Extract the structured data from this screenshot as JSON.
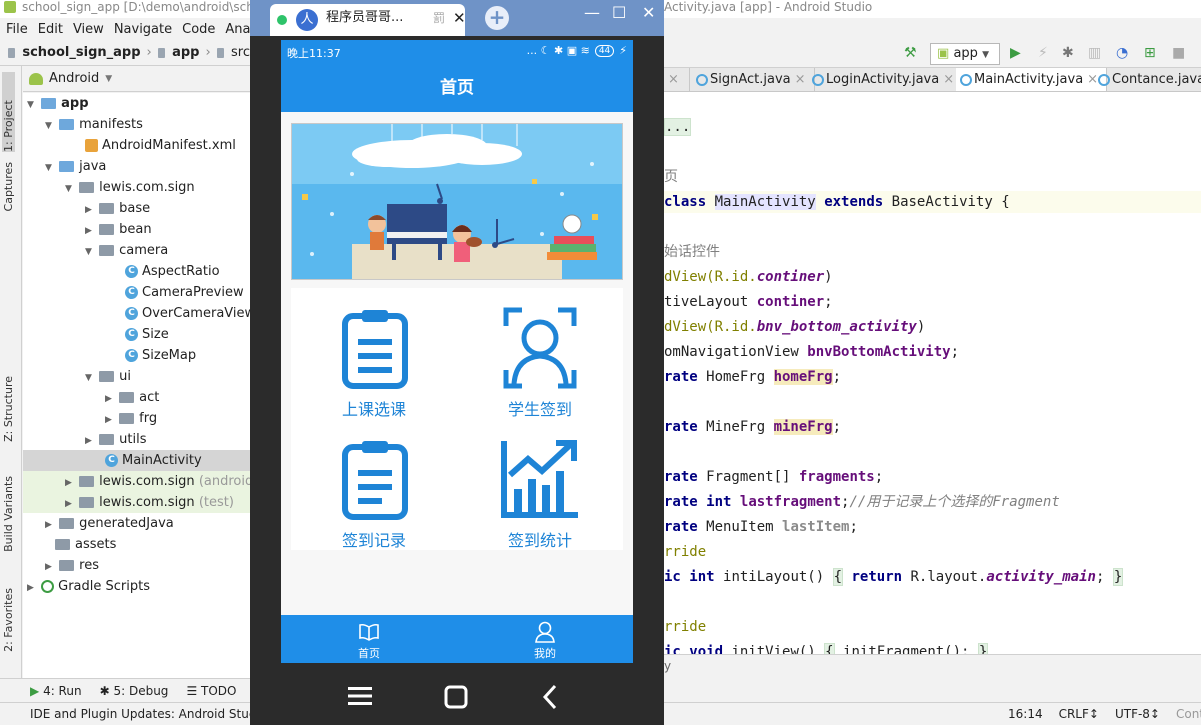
{
  "ide": {
    "title_left": "school_sign_app [D:\\demo\\android\\sch",
    "title_right": "Activity.java [app] - Android Studio",
    "menu": [
      "File",
      "Edit",
      "View",
      "Navigate",
      "Code",
      "Analy"
    ],
    "breadcrumb": [
      "school_sign_app",
      "app",
      "src"
    ],
    "project_view": "Android",
    "left_tabs": [
      "1: Project",
      "Captures",
      "Z: Structure",
      "Build Variants",
      "2: Favorites"
    ],
    "tree": [
      {
        "label": "app",
        "type": "module"
      },
      {
        "label": "manifests",
        "type": "folder"
      },
      {
        "label": "AndroidManifest.xml",
        "type": "xml"
      },
      {
        "label": "java",
        "type": "folder"
      },
      {
        "label": "lewis.com.sign",
        "type": "package"
      },
      {
        "label": "base",
        "type": "package"
      },
      {
        "label": "bean",
        "type": "package"
      },
      {
        "label": "camera",
        "type": "package"
      },
      {
        "label": "AspectRatio",
        "type": "class"
      },
      {
        "label": "CameraPreview",
        "type": "class"
      },
      {
        "label": "OverCameraView",
        "type": "class"
      },
      {
        "label": "Size",
        "type": "class"
      },
      {
        "label": "SizeMap",
        "type": "class"
      },
      {
        "label": "ui",
        "type": "package"
      },
      {
        "label": "act",
        "type": "package"
      },
      {
        "label": "frg",
        "type": "package"
      },
      {
        "label": "utils",
        "type": "package"
      },
      {
        "label": "MainActivity",
        "type": "class"
      },
      {
        "label": "lewis.com.sign",
        "suffix": "(androidTe",
        "type": "package"
      },
      {
        "label": "lewis.com.sign",
        "suffix": "(test)",
        "type": "package"
      },
      {
        "label": "generatedJava",
        "type": "folder"
      },
      {
        "label": "assets",
        "type": "folder"
      },
      {
        "label": "res",
        "type": "folder"
      },
      {
        "label": "Gradle Scripts",
        "type": "gradle"
      }
    ],
    "bottom_tools": [
      "4: Run",
      "5: Debug",
      "TODO"
    ],
    "status_message": "IDE and Plugin Updates: Android Stuc",
    "status_right": [
      "16:14",
      "CRLF↕",
      "UTF-8↕",
      "Context:"
    ],
    "run_config": "app",
    "editor_tabs": [
      {
        "label": "SignAct.java",
        "active": false
      },
      {
        "label": "LoginActivity.java",
        "active": false
      },
      {
        "label": "MainActivity.java",
        "active": true
      },
      {
        "label": "Contance.java",
        "active": false
      }
    ],
    "code": {
      "l1": "...",
      "l2": "页",
      "l3a": "class",
      "l3b": "MainActivity",
      "l3c": "extends",
      "l3d": "BaseActivity {",
      "l4": "始话控件",
      "l5a": "dView(R.id.",
      "l5b": "continer",
      "l5c": ")",
      "l6a": "tiveLayout ",
      "l6b": "continer",
      "l6c": ";",
      "l7a": "dView(R.id.",
      "l7b": "bnv_bottom_activity",
      "l7c": ")",
      "l8a": "omNavigationView ",
      "l8b": "bnvBottomActivity",
      "l8c": ";",
      "l9a": "rate",
      "l9b": " HomeFrg ",
      "l9c": "homeFrg",
      "l9d": ";",
      "l10a": "rate",
      "l10b": " MineFrg ",
      "l10c": "mineFrg",
      "l10d": ";",
      "l11a": "rate",
      "l11b": " Fragment[] ",
      "l11c": "fragments",
      "l11d": ";",
      "l12a": "rate",
      "l12b": "int",
      "l12c": "lastfragment",
      "l12d": ";",
      "l12e": "//用于记录上个选择的Fragment",
      "l13a": "rate",
      "l13b": " MenuItem ",
      "l13c": "lastItem",
      "l13d": ";",
      "l14": "rride",
      "l15a": "ic",
      "l15b": "int",
      "l15c": " intiLayout() ",
      "l15d": "{",
      "l15e": "return",
      "l15f": " R.layout.",
      "l15g": "activity_main",
      "l15h": ";",
      "l15i": "}",
      "l16": "rride",
      "l17a": "ic",
      "l17b": "void",
      "l17c": " initView() ",
      "l17d": "{",
      "l17e": " initFragment(); ",
      "l17f": "}",
      "l18": "y"
    }
  },
  "mirror": {
    "tab_title": "程序员哥哥...",
    "avatar_char": "人",
    "pin_char": "罰"
  },
  "phone": {
    "time": "晚上11:37",
    "status_icons": "... ☾ ✱ ▣ ≋",
    "battery": "44",
    "title": "首页",
    "grid": [
      {
        "label": "上课选课",
        "icon": "clipboard-icon"
      },
      {
        "label": "学生签到",
        "icon": "face-scan-icon"
      },
      {
        "label": "签到记录",
        "icon": "record-icon"
      },
      {
        "label": "签到统计",
        "icon": "stats-icon"
      }
    ],
    "nav": [
      {
        "label": "首页",
        "icon": "book-icon"
      },
      {
        "label": "我的",
        "icon": "person-icon"
      }
    ]
  },
  "colors": {
    "phone_primary": "#1f8ee8",
    "icon_blue": "#1e84d6",
    "mirror_title": "#6f93c7"
  }
}
